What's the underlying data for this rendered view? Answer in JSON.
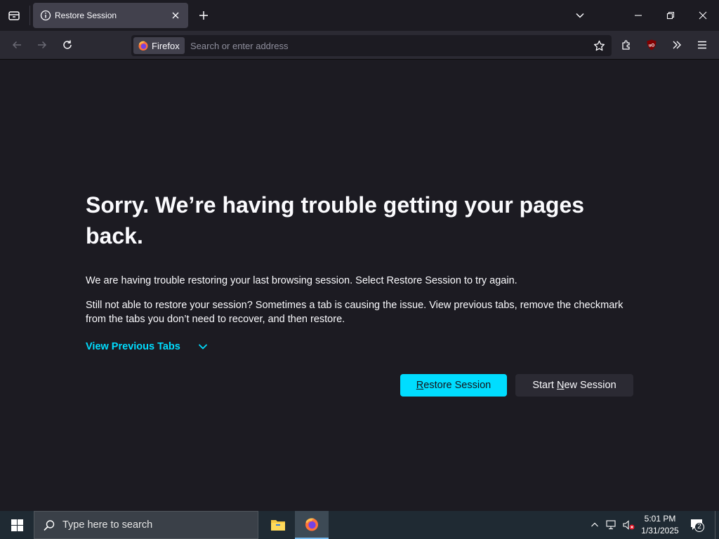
{
  "tabs": [
    {
      "title": "Restore Session",
      "active": true
    }
  ],
  "urlbar": {
    "identity_label": "Firefox",
    "placeholder": "Search or enter address"
  },
  "content": {
    "heading": "Sorry. We’re having trouble getting your pages back.",
    "paragraph1": "We are having trouble restoring your last browsing session. Select Restore Session to try again.",
    "paragraph2": "Still not able to restore your session? Sometimes a tab is causing the issue. View previous tabs, remove the checkmark from the tabs you don’t need to recover, and then restore.",
    "view_previous_label": "View Previous Tabs",
    "restore_button": {
      "pre": "",
      "accesskey": "R",
      "post": "estore Session"
    },
    "new_session_button": {
      "pre": "Start ",
      "accesskey": "N",
      "post": "ew Session"
    }
  },
  "taskbar": {
    "search_placeholder": "Type here to search",
    "time": "5:01 PM",
    "date": "1/31/2025",
    "notification_count": "2"
  },
  "colors": {
    "accent": "#00ddff",
    "background": "#1c1b22",
    "toolbar": "#2b2a33",
    "tab_active": "#42414d",
    "taskbar": "#1f2a33"
  },
  "icons": {
    "tab_list": "tab-list-icon",
    "tab_info": "info-icon",
    "tab_close": "close-icon",
    "new_tab": "plus-icon",
    "list_all_tabs": "chevron-down-icon",
    "minimize": "minimize-icon",
    "restore_window": "restore-window-icon",
    "close_window": "close-window-icon",
    "back": "back-arrow-icon",
    "forward": "forward-arrow-icon",
    "reload": "reload-icon",
    "bookmark": "star-icon",
    "extensions": "puzzle-icon",
    "ublock": "ublock-origin-icon",
    "overflow": "double-chevron-icon",
    "menu": "hamburger-menu-icon",
    "windows_start": "windows-logo-icon",
    "taskbar_search": "search-icon",
    "file_explorer": "folder-icon",
    "firefox": "firefox-icon",
    "tray_chevron": "chevron-up-icon",
    "network": "network-icon",
    "volume": "volume-muted-icon",
    "notifications": "notification-icon"
  }
}
